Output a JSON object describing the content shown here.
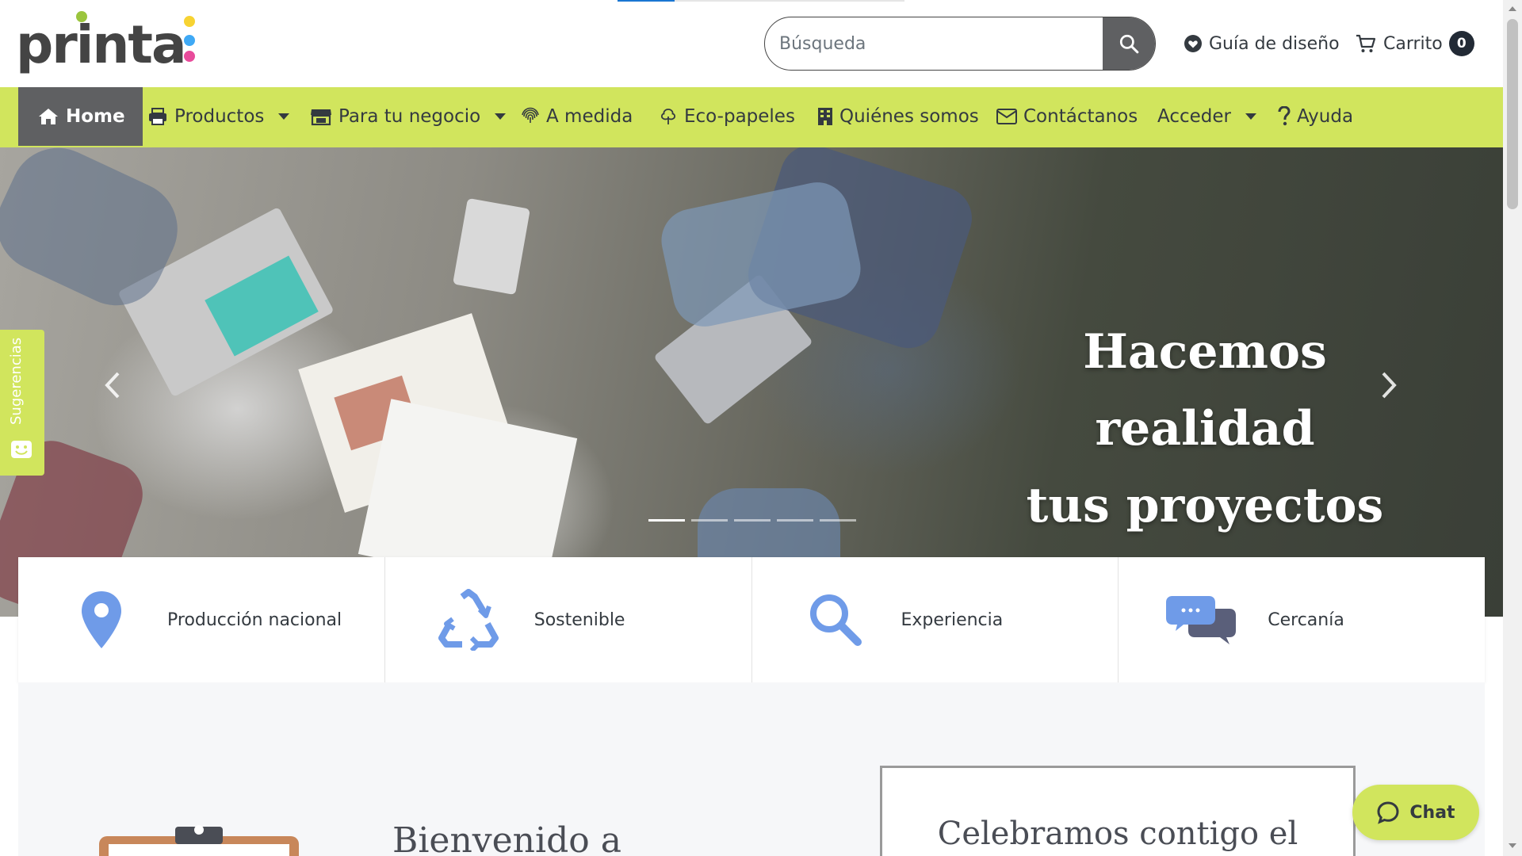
{
  "brand": {
    "logo_text": "printa",
    "dot_colors": [
      "#9bc53d",
      "#f7d332",
      "#3fa9f5",
      "#e84b9b"
    ]
  },
  "search": {
    "placeholder": "Búsqueda",
    "value": "",
    "icon": "search-icon"
  },
  "header_links": {
    "guide": {
      "label": "Guía de diseño",
      "icon": "heart-icon"
    },
    "cart": {
      "label": "Carrito",
      "icon": "cart-icon",
      "count": "0"
    }
  },
  "nav": {
    "items": [
      {
        "label": "Home",
        "icon": "home-icon",
        "active": true
      },
      {
        "label": "Productos",
        "icon": "printer-icon",
        "dropdown": true
      },
      {
        "label": "Para tu negocio",
        "icon": "store-icon",
        "dropdown": true
      },
      {
        "label": "A medida",
        "icon": "fingerprint-icon"
      },
      {
        "label": "Eco-papeles",
        "icon": "tree-icon"
      },
      {
        "label": "Quiénes somos",
        "icon": "building-icon"
      },
      {
        "label": "Contáctanos",
        "icon": "envelope-icon"
      },
      {
        "label": "Acceder",
        "dropdown": true
      },
      {
        "label": "Ayuda",
        "icon": "question-icon"
      }
    ]
  },
  "hero": {
    "title_line1": "Hacemos realidad",
    "title_line2": "tus proyectos",
    "slide_count": 5,
    "active_slide": 1
  },
  "side_tab": {
    "label": "Sugerencias",
    "icon": "smile-icon"
  },
  "features": [
    {
      "label": "Producción nacional",
      "icon": "map-pin-icon"
    },
    {
      "label": "Sostenible",
      "icon": "recycle-icon"
    },
    {
      "label": "Experiencia",
      "icon": "magnifier-icon"
    },
    {
      "label": "Cercanía",
      "icon": "chat-bubbles-icon"
    }
  ],
  "lower": {
    "welcome_text": "Bienvenido a",
    "celebrate_text": "Celebramos contigo el"
  },
  "chat": {
    "label": "Chat",
    "icon": "chat-bubble-icon"
  },
  "colors": {
    "accent_green": "#d1e55d",
    "active_nav_gray": "#5f6062",
    "icon_blue": "#6f9be8",
    "text_dark": "#343a40"
  }
}
